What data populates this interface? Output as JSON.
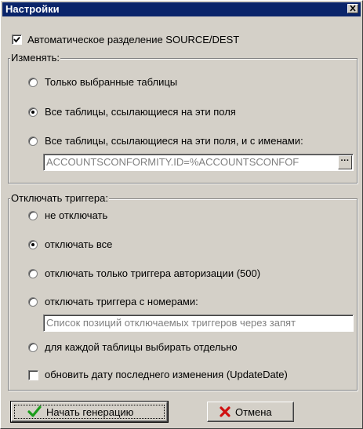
{
  "window": {
    "title": "Настройки",
    "close_glyph": "×"
  },
  "auto_split": {
    "label": "Автоматическое разделение SOURCE/DEST",
    "checked": true
  },
  "change_group": {
    "title": "Изменять:",
    "options": [
      {
        "label": "Только выбранные таблицы",
        "selected": false
      },
      {
        "label": "Все таблицы, ссылающиеся на эти поля",
        "selected": true
      },
      {
        "label": "Все таблицы, ссылающиеся на эти поля, и с именами:",
        "selected": false
      }
    ],
    "names_value": "ACCOUNTSCONFORMITY.ID=%ACCOUNTSCONFOF",
    "ellipsis_label": "···"
  },
  "triggers_group": {
    "title": "Отключать триггера:",
    "options": [
      {
        "label": "не отключать",
        "selected": false
      },
      {
        "label": "отключать все",
        "selected": true
      },
      {
        "label": "отключать только триггера авторизации (500)",
        "selected": false
      },
      {
        "label": "отключать триггера с номерами:",
        "selected": false
      },
      {
        "label": "для каждой таблицы выбирать отдельно",
        "selected": false
      }
    ],
    "numbers_placeholder": "Список позиций отключаемых триггеров через запят",
    "update_date": {
      "label": "обновить дату последнего изменения (UpdateDate)",
      "checked": false
    }
  },
  "buttons": {
    "start": {
      "label": "Начать генерацию",
      "icon": "green-checkmark-icon"
    },
    "cancel": {
      "label": "Отмена",
      "icon": "red-x-icon"
    }
  },
  "colors": {
    "title_bar": "#0a246a",
    "face": "#d4d0c8",
    "check_green": "#1a9c1a",
    "cancel_red": "#d01010"
  }
}
